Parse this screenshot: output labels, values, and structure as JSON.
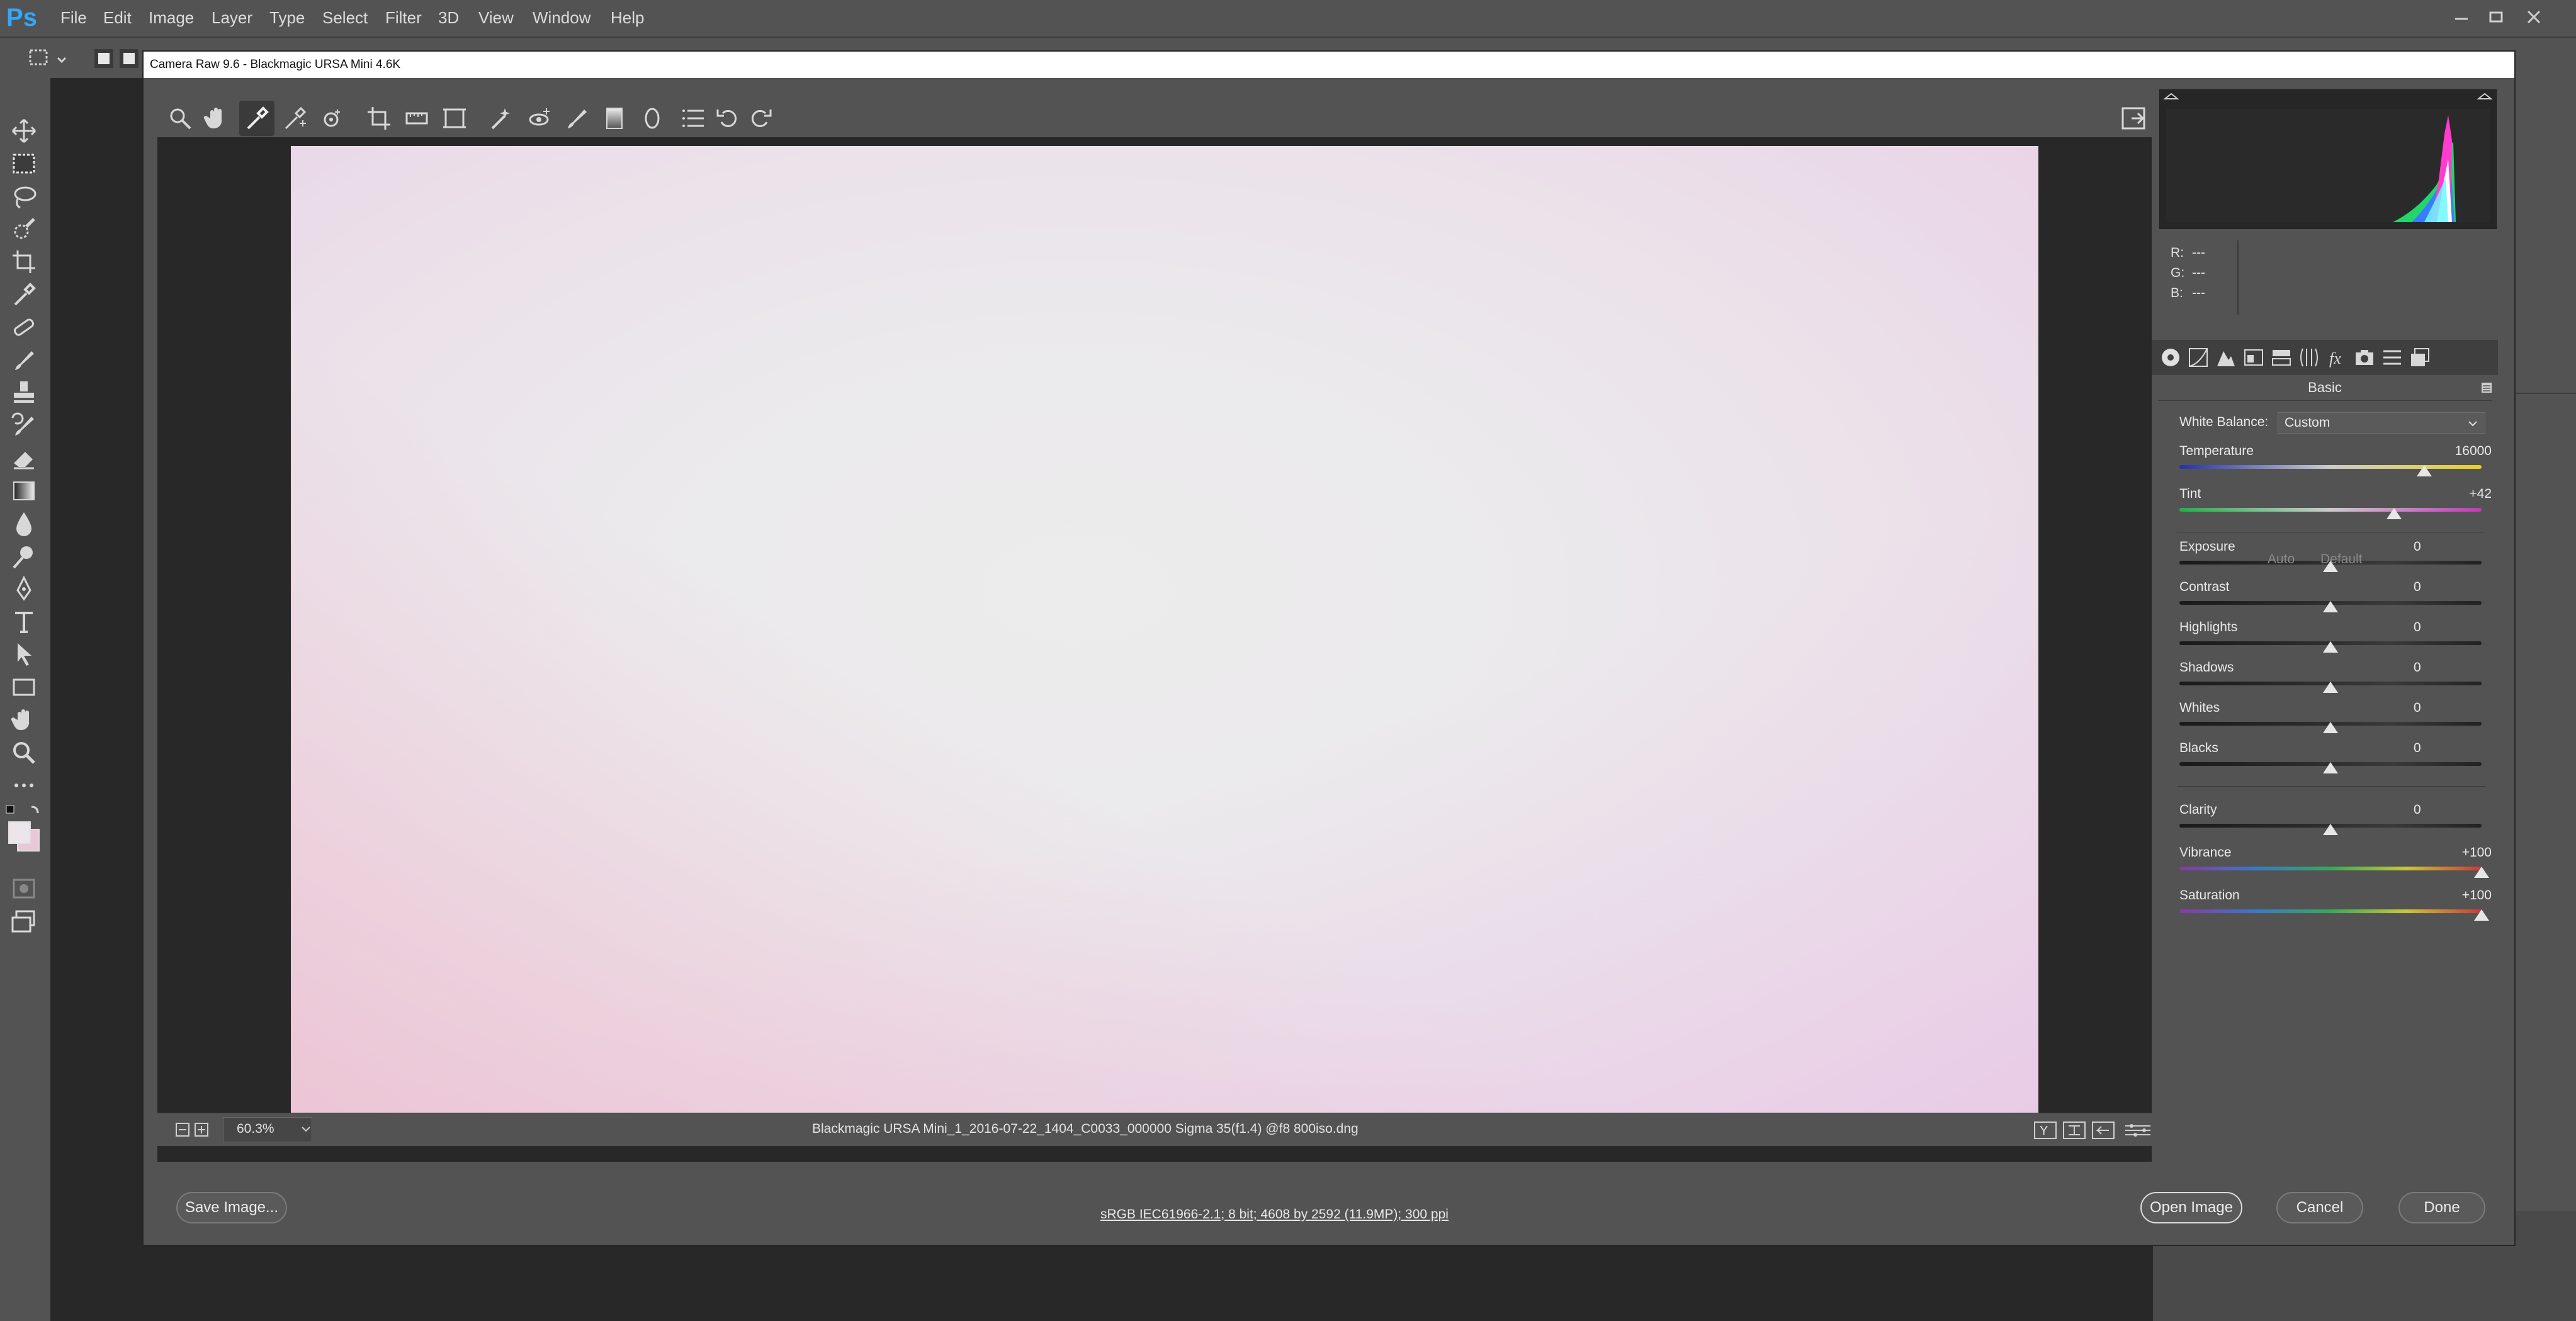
{
  "app": {
    "menus": [
      "File",
      "Edit",
      "Image",
      "Layer",
      "Type",
      "Select",
      "Filter",
      "3D",
      "View",
      "Window",
      "Help"
    ],
    "logo": "Ps"
  },
  "dialog": {
    "title": "Camera Raw 9.6  -  Blackmagic URSA Mini 4.6K",
    "zoom": "60.3%",
    "filename": "Blackmagic URSA Mini_1_2016-07-22_1404_C0033_000000 Sigma 35(f1.4) @f8 800iso.dng",
    "workflow": "sRGB IEC61966-2.1; 8 bit; 4608 by 2592 (11.9MP); 300 ppi",
    "buttons": {
      "save": "Save Image...",
      "open": "Open Image",
      "cancel": "Cancel",
      "done": "Done"
    }
  },
  "readout": {
    "r_label": "R:",
    "r_value": "---",
    "g_label": "G:",
    "g_value": "---",
    "b_label": "B:",
    "b_value": "---"
  },
  "basic": {
    "panel_title": "Basic",
    "white_balance_label": "White Balance:",
    "white_balance_value": "Custom",
    "auto": "Auto",
    "default": "Default",
    "sliders": [
      {
        "label": "Temperature",
        "value": "16000",
        "level": 0.81
      },
      {
        "label": "Tint",
        "value": "+42",
        "level": 0.71
      },
      {
        "label": "Exposure",
        "value": "0",
        "level": 0.5
      },
      {
        "label": "Contrast",
        "value": "0",
        "level": 0.5
      },
      {
        "label": "Highlights",
        "value": "0",
        "level": 0.5
      },
      {
        "label": "Shadows",
        "value": "0",
        "level": 0.5
      },
      {
        "label": "Whites",
        "value": "0",
        "level": 0.5
      },
      {
        "label": "Blacks",
        "value": "0",
        "level": 0.5
      },
      {
        "label": "Clarity",
        "value": "0",
        "level": 0.5
      },
      {
        "label": "Vibrance",
        "value": "+100",
        "level": 1.0
      },
      {
        "label": "Saturation",
        "value": "+100",
        "level": 1.0
      }
    ]
  },
  "colors": {
    "accent": "#31a8ff",
    "preview_center": "#ececec",
    "preview_corner_left": "#eecad6",
    "preview_corner_right": "#e8cfe6"
  }
}
